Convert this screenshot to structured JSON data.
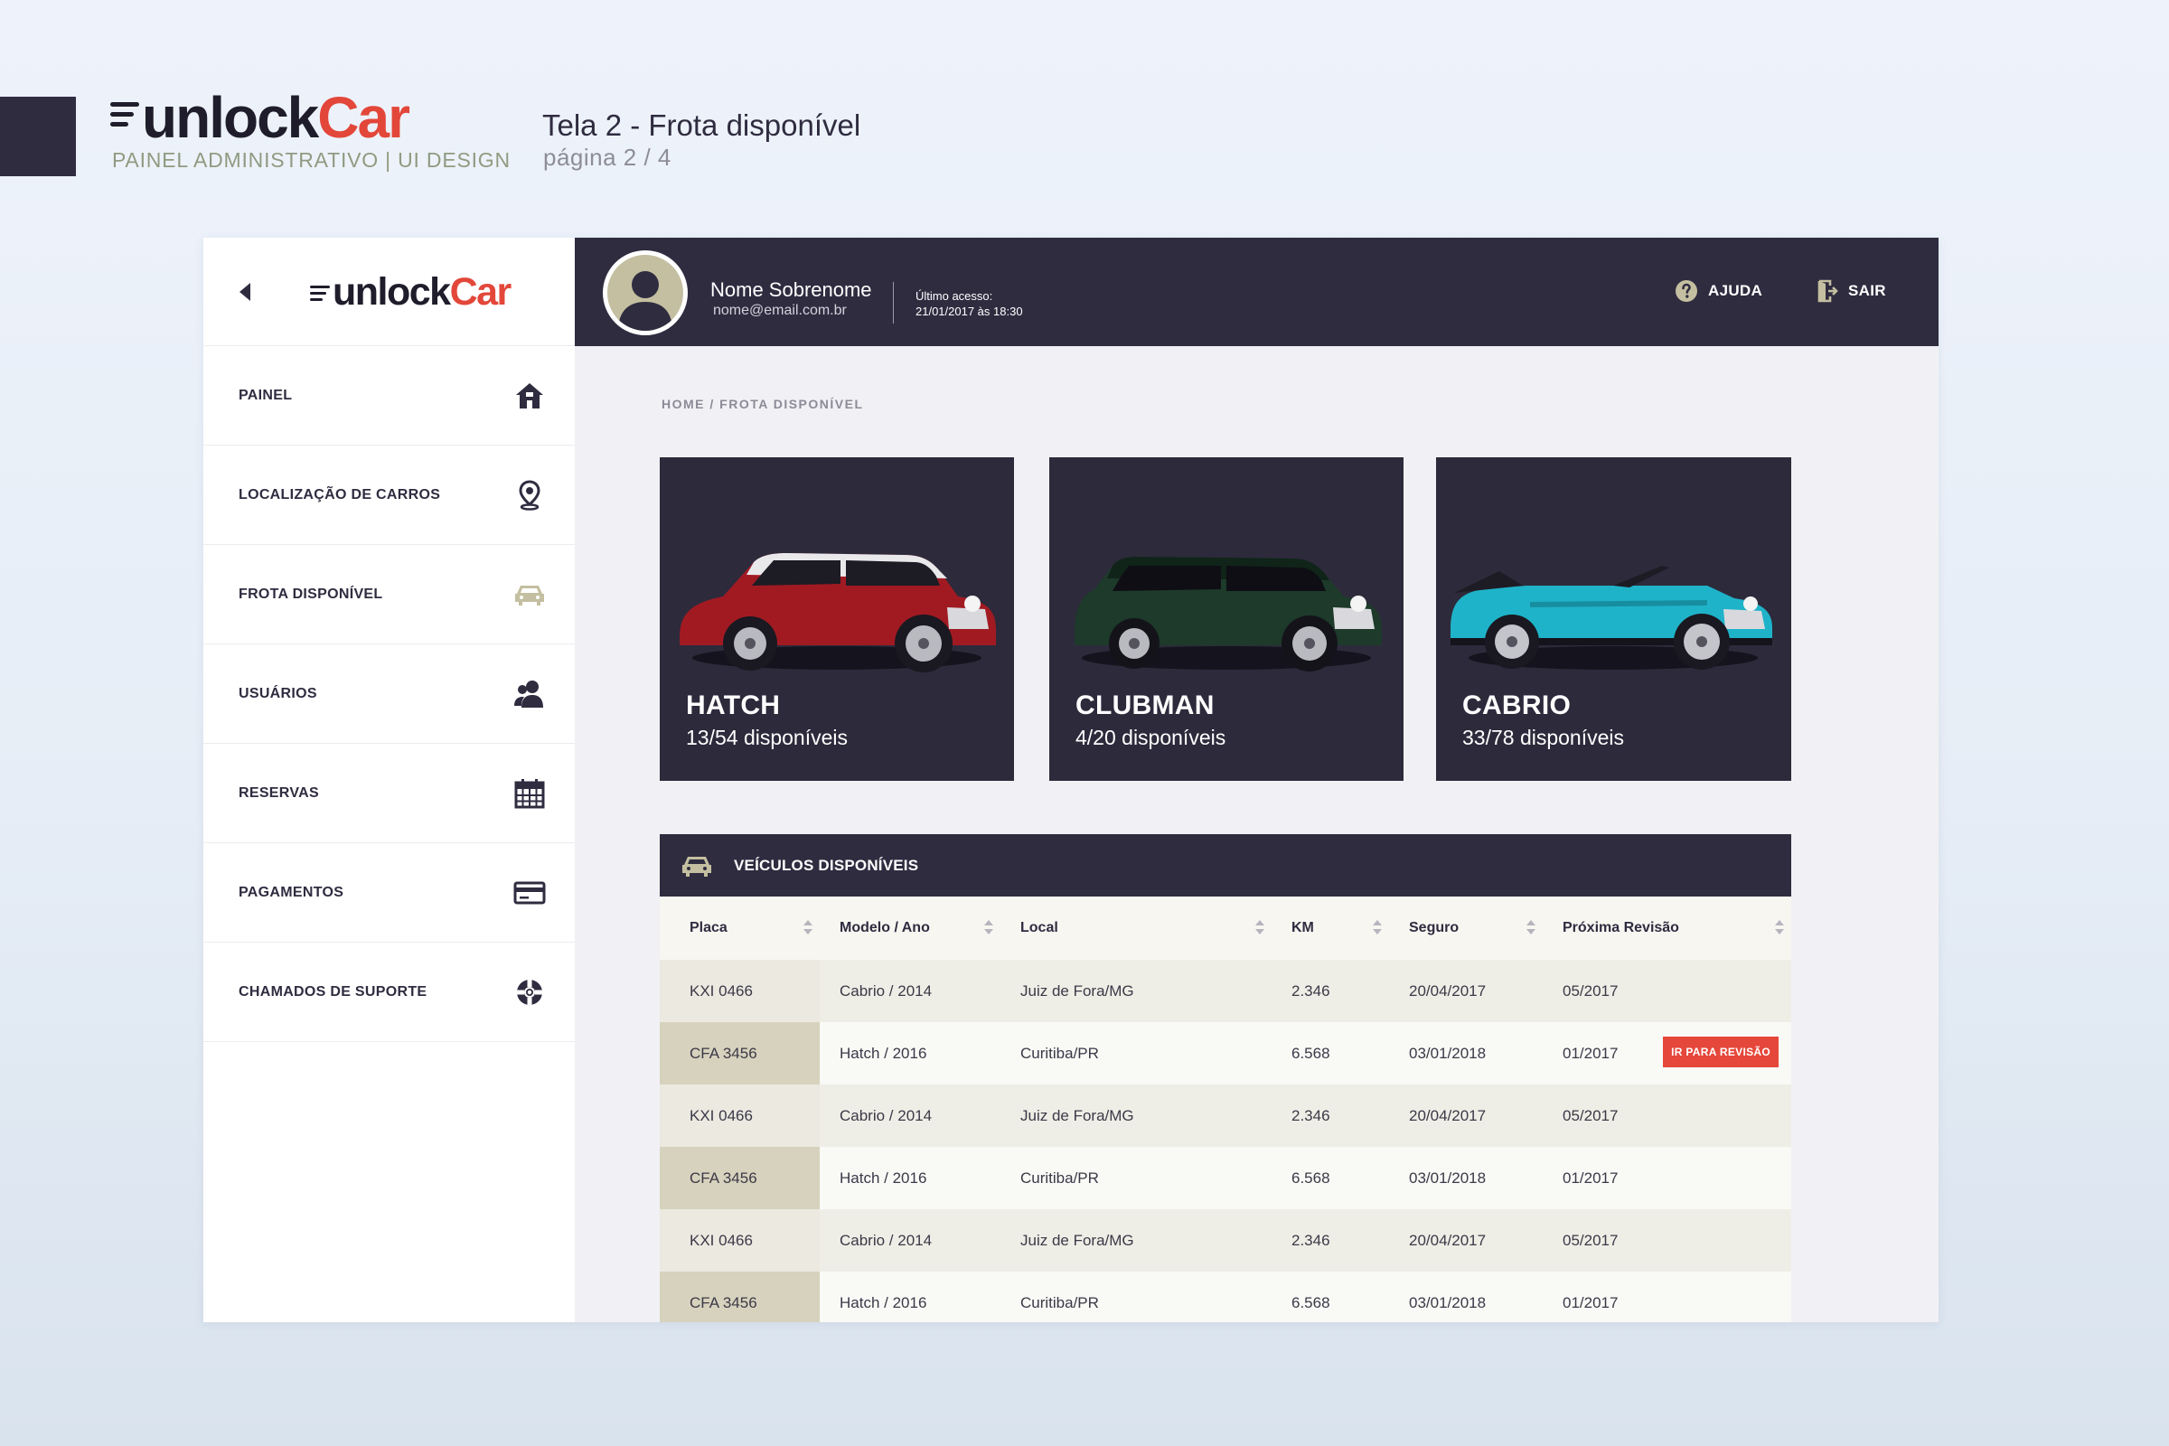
{
  "presentation": {
    "brand_unlock": "unlock",
    "brand_car": "Car",
    "subtitle": "PAINEL ADMINISTRATIVO | UI DESIGN",
    "title": "Tela 2 - Frota disponível",
    "page": "página 2 / 4"
  },
  "sidebar": {
    "brand_unlock": "unlock",
    "brand_car": "Car",
    "items": [
      {
        "label": "PAINEL",
        "icon": "home-icon"
      },
      {
        "label": "LOCALIZAÇÃO DE CARROS",
        "icon": "map-pin-icon"
      },
      {
        "label": "FROTA DISPONÍVEL",
        "icon": "car-icon"
      },
      {
        "label": "USUÁRIOS",
        "icon": "users-icon"
      },
      {
        "label": "RESERVAS",
        "icon": "calendar-icon"
      },
      {
        "label": "PAGAMENTOS",
        "icon": "credit-card-icon"
      },
      {
        "label": "CHAMADOS DE SUPORTE",
        "icon": "lifebuoy-icon"
      }
    ],
    "active_index": 2
  },
  "topbar": {
    "user_name": "Nome Sobrenome",
    "user_email": "nome@email.com.br",
    "last_access_label": "Último acesso:",
    "last_access_value": "21/01/2017 às 18:30",
    "help_label": "AJUDA",
    "exit_label": "SAIR"
  },
  "breadcrumb": "HOME / FROTA DISPONÍVEL",
  "cards": [
    {
      "name": "HATCH",
      "availability": "13/54 disponíveis",
      "color": "#a11a22"
    },
    {
      "name": "CLUBMAN",
      "availability": "4/20 disponíveis",
      "color": "#1d3a2a"
    },
    {
      "name": "CABRIO",
      "availability": "33/78 disponíveis",
      "color": "#1fb3c9"
    }
  ],
  "table": {
    "title": "VEÍCULOS DISPONÍVEIS",
    "columns": [
      "Placa",
      "Modelo / Ano",
      "Local",
      "KM",
      "Seguro",
      "Próxima Revisão"
    ],
    "action_label": "IR PARA REVISÃO",
    "rows": [
      {
        "placa": "KXI 0466",
        "modelo": "Cabrio / 2014",
        "local": "Juiz de Fora/MG",
        "km": "2.346",
        "seguro": "20/04/2017",
        "revisao": "05/2017",
        "action": false
      },
      {
        "placa": "CFA 3456",
        "modelo": "Hatch / 2016",
        "local": "Curitiba/PR",
        "km": "6.568",
        "seguro": "03/01/2018",
        "revisao": "01/2017",
        "action": true
      },
      {
        "placa": "KXI 0466",
        "modelo": "Cabrio / 2014",
        "local": "Juiz de Fora/MG",
        "km": "2.346",
        "seguro": "20/04/2017",
        "revisao": "05/2017",
        "action": false
      },
      {
        "placa": "CFA 3456",
        "modelo": "Hatch / 2016",
        "local": "Curitiba/PR",
        "km": "6.568",
        "seguro": "03/01/2018",
        "revisao": "01/2017",
        "action": false
      },
      {
        "placa": "KXI 0466",
        "modelo": "Cabrio / 2014",
        "local": "Juiz de Fora/MG",
        "km": "2.346",
        "seguro": "20/04/2017",
        "revisao": "05/2017",
        "action": false
      },
      {
        "placa": "CFA 3456",
        "modelo": "Hatch / 2016",
        "local": "Curitiba/PR",
        "km": "6.568",
        "seguro": "03/01/2018",
        "revisao": "01/2017",
        "action": false
      }
    ]
  },
  "colors": {
    "dark": "#2f2c40",
    "accent": "#e2473a",
    "active_icon": "#c4bfa0"
  }
}
